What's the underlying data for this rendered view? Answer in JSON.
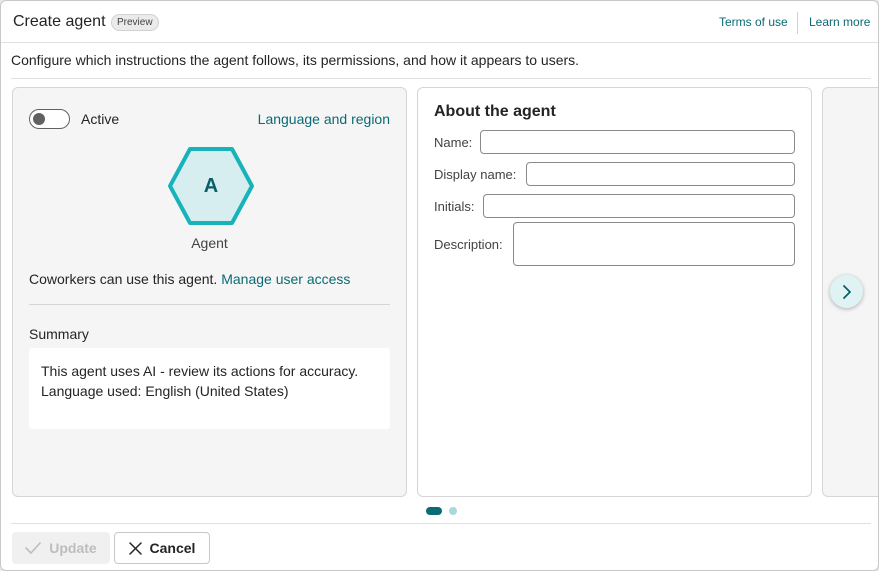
{
  "header": {
    "title": "Create agent",
    "badge": "Preview",
    "terms_link": "Terms of use",
    "learn_link": "Learn more"
  },
  "subtitle": "Configure which instructions the agent follows, its permissions, and how it appears to users.",
  "left_card": {
    "toggle_label": "Active",
    "toggle_on": false,
    "language_link": "Language and region",
    "avatar_initial": "A",
    "agent_name": "Agent",
    "access_text": "Coworkers can use this agent.",
    "access_link": "Manage user access",
    "summary_label": "Summary",
    "summary_lines": [
      "This agent uses AI - review its actions for accuracy.",
      "Language used: English (United States)"
    ]
  },
  "about": {
    "heading": "About the agent",
    "fields": [
      {
        "label": "Name:",
        "value": ""
      },
      {
        "label": "Display name:",
        "value": ""
      },
      {
        "label": "Initials:",
        "value": ""
      },
      {
        "label": "Description:",
        "value": ""
      }
    ]
  },
  "pager": {
    "pages": 2,
    "current": 1
  },
  "footer": {
    "update_label": "Update",
    "cancel_label": "Cancel"
  },
  "colors": {
    "accent": "#0b6a73",
    "hex_stroke": "#17b3ba",
    "hex_fill": "#d6eef0"
  }
}
